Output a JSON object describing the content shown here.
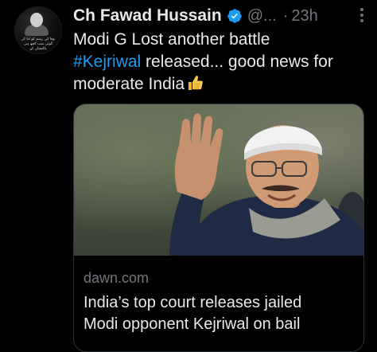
{
  "author": {
    "name": "Ch Fawad Hussain",
    "handle": "@...",
    "separator": "·",
    "time": "23h",
    "avatar_text": [
      "وفا کی رسم کو ادا کر",
      "گوئی سب کچھ ہی",
      "پاکستان کے"
    ]
  },
  "tweet": {
    "line1": "Modi G Lost another battle",
    "hashtag": "#Kejriwal",
    "line2_rest": " released... good news for",
    "line3": "moderate India",
    "emoji": "thumbs-up"
  },
  "card": {
    "domain": "dawn.com",
    "title_line1": "India’s top court releases jailed",
    "title_line2": "Modi opponent Kejriwal on bail"
  },
  "icons": {
    "verified": "verified-badge-icon",
    "more": "more-options-icon"
  },
  "colors": {
    "background": "#000000",
    "text": "#e7e9ea",
    "secondary": "#71767b",
    "link": "#1d9bf0",
    "border": "#2f3336"
  }
}
